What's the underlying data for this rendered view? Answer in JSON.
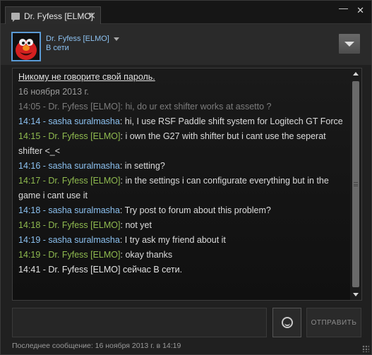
{
  "tab": {
    "title": "Dr. Fyfess [ELMO]",
    "close": "✕"
  },
  "window": {
    "minimize": "—",
    "close": "✕"
  },
  "header": {
    "name": "Dr. Fyfess [ELMO]",
    "status": "В сети"
  },
  "chat": {
    "notice": "Никому не говорите свой пароль.",
    "date": "16 ноября 2013 г.",
    "messages": [
      {
        "time": "14:05",
        "sender": "Dr. Fyfess [ELMO]",
        "text": "hi, do ur ext shifter works at assetto ?",
        "style": "faded"
      },
      {
        "time": "14:14",
        "sender": "sasha suralmasha",
        "text": "hi, I use  RSF Paddle shift system for Logitech GT Force",
        "style": "sasha"
      },
      {
        "time": "14:15",
        "sender": "Dr. Fyfess [ELMO]",
        "text": "i own the G27 with shifter but i cant use the seperat shifter <_<",
        "style": "fyfess"
      },
      {
        "time": "14:16",
        "sender": "sasha suralmasha",
        "text": "in setting?",
        "style": "sasha"
      },
      {
        "time": "14:17",
        "sender": "Dr. Fyfess [ELMO]",
        "text": "in the settings i can configurate everything but in the game i cant use it",
        "style": "fyfess"
      },
      {
        "time": "14:18",
        "sender": "sasha suralmasha",
        "text": "Try post to forum about this problem?",
        "style": "sasha"
      },
      {
        "time": "14:18",
        "sender": "Dr. Fyfess [ELMO]",
        "text": "not yet",
        "style": "fyfess"
      },
      {
        "time": "14:19",
        "sender": "sasha suralmasha",
        "text": "I try ask my friend about it",
        "style": "sasha"
      },
      {
        "time": "14:19",
        "sender": "Dr. Fyfess [ELMO]",
        "text": "okay thanks",
        "style": "fyfess"
      }
    ],
    "system": {
      "time": "14:41",
      "text": "Dr. Fyfess [ELMO] сейчас В сети."
    }
  },
  "input": {
    "placeholder": ""
  },
  "send_label": "ОТПРАВИТЬ",
  "footer": "Последнее сообщение: 16 ноября 2013 г. в 14:19",
  "colors": {
    "sasha": "#8cc1f0",
    "fyfess": "#8fba4f",
    "faded": "#7c7c7c",
    "accent": "#5b9bd5"
  }
}
